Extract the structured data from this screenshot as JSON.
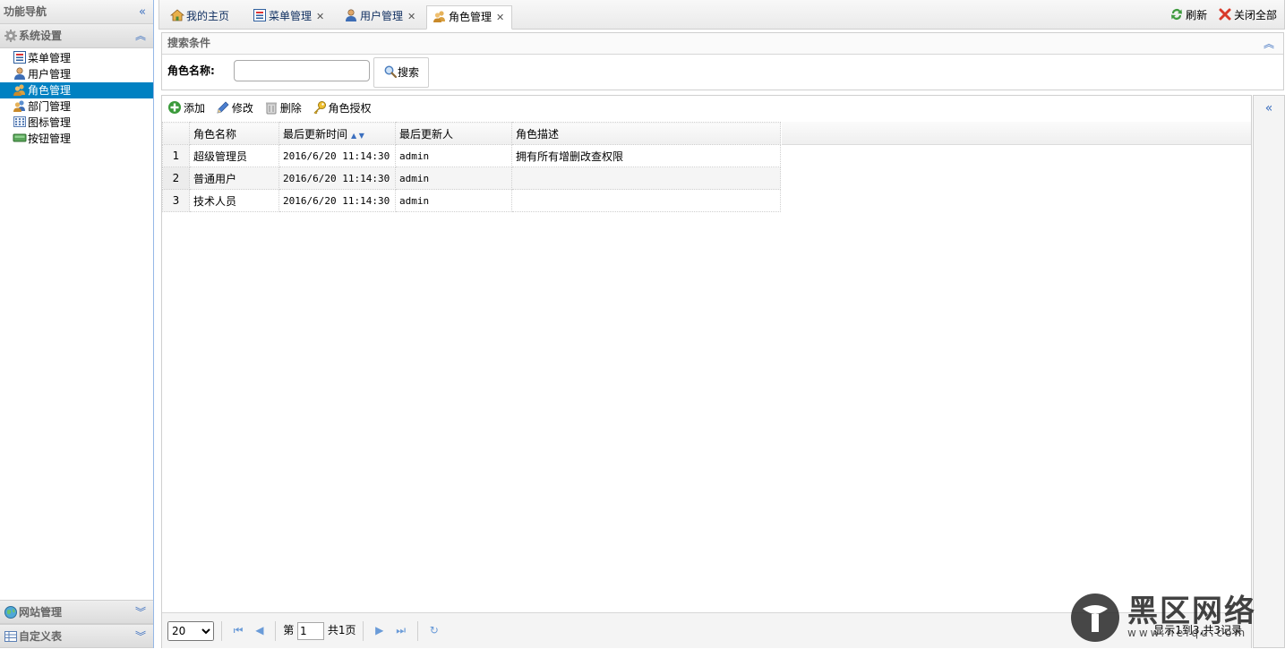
{
  "nav": {
    "title": "功能导航",
    "collapse_icon": "double-chevron-left-icon",
    "system": {
      "label": "系统设置",
      "items": [
        {
          "label": "菜单管理",
          "icon": "menu-icon"
        },
        {
          "label": "用户管理",
          "icon": "user-icon"
        },
        {
          "label": "角色管理",
          "icon": "users-icon",
          "selected": true
        },
        {
          "label": "部门管理",
          "icon": "department-icon"
        },
        {
          "label": "图标管理",
          "icon": "icon-grid-icon"
        },
        {
          "label": "按钮管理",
          "icon": "button-icon"
        }
      ]
    },
    "website": {
      "label": "网站管理"
    },
    "custom": {
      "label": "自定义表"
    }
  },
  "tabs": [
    {
      "label": "我的主页",
      "icon": "home-icon",
      "closable": false
    },
    {
      "label": "菜单管理",
      "icon": "menu-icon",
      "closable": true
    },
    {
      "label": "用户管理",
      "icon": "user-icon",
      "closable": true
    },
    {
      "label": "角色管理",
      "icon": "users-icon",
      "closable": true,
      "active": true
    }
  ],
  "tab_tools": {
    "refresh": "刷新",
    "close_all": "关闭全部"
  },
  "search": {
    "title": "搜索条件",
    "field_label": "角色名称:",
    "field_value": "",
    "button": "搜索"
  },
  "toolbar": {
    "add": "添加",
    "edit": "修改",
    "delete": "删除",
    "authorize": "角色授权"
  },
  "grid": {
    "columns": [
      "角色名称",
      "最后更新时间",
      "最后更新人",
      "角色描述"
    ],
    "rows": [
      {
        "no": "1",
        "name": "超级管理员",
        "time": "2016/6/20 11:14:30",
        "user": "admin",
        "desc": "拥有所有增删改查权限"
      },
      {
        "no": "2",
        "name": "普通用户",
        "time": "2016/6/20 11:14:30",
        "user": "admin",
        "desc": ""
      },
      {
        "no": "3",
        "name": "技术人员",
        "time": "2016/6/20 11:14:30",
        "user": "admin",
        "desc": ""
      }
    ]
  },
  "pager": {
    "page_size": "20",
    "page_prefix": "第",
    "page_value": "1",
    "page_suffix": "共1页",
    "info": "显示1到3,共3记录"
  },
  "watermark": {
    "text": "黑区网络",
    "sub": "www.heiqu.com"
  },
  "colors": {
    "accent": "#0081c2",
    "border": "#95b8e7",
    "icon_blue": "#3b6fbf"
  }
}
